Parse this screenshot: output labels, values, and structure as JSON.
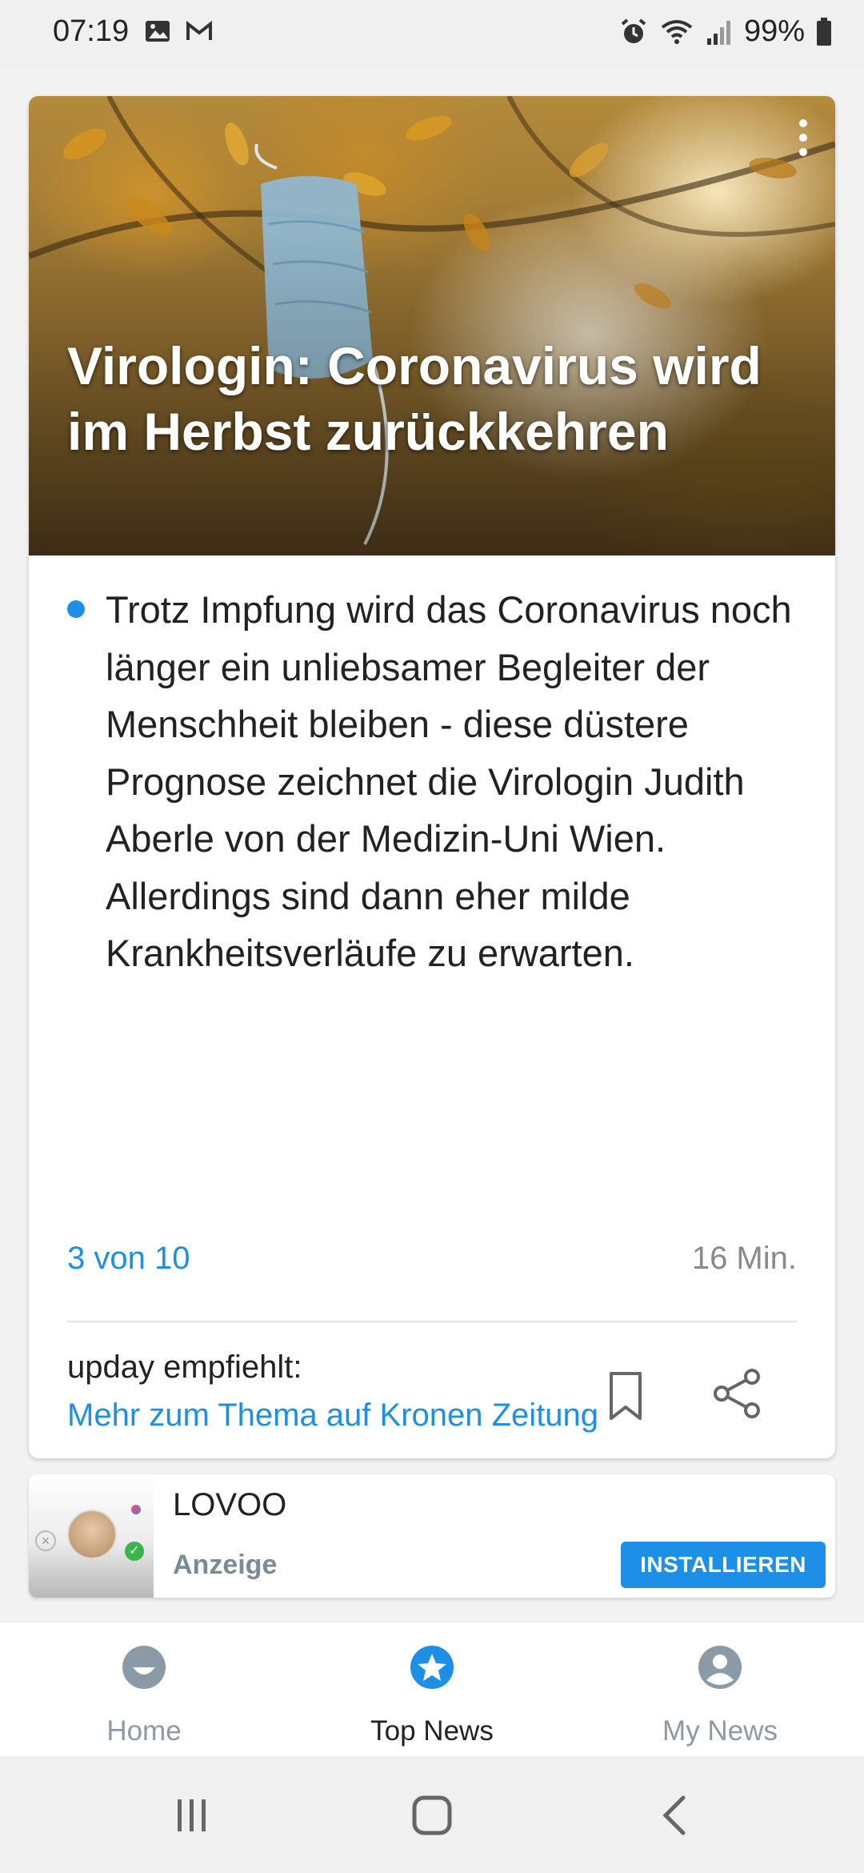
{
  "status_bar": {
    "time": "07:19",
    "battery": "99%",
    "left_icons": [
      "image-icon",
      "gmail-icon"
    ],
    "right_icons": [
      "alarm-icon",
      "wifi-icon",
      "signal-icon",
      "battery-icon"
    ]
  },
  "article": {
    "headline": "Virologin: Coronavirus wird im Herbst zurückkehren",
    "body": "Trotz Impfung wird das Coronavirus noch länger ein unliebsamer Begleiter der Menschheit bleiben - diese düstere Prognose zeichnet die Virologin Judith Aberle von der Medizin-Uni Wien. Allerdings sind dann eher milde Krankheitsverläufe zu erwarten.",
    "counter": "3 von 10",
    "duration": "16 Min.",
    "recommend_label": "upday empfiehlt:",
    "recommend_link": "Mehr zum Thema auf Kronen Zeitung"
  },
  "ad": {
    "title": "LOVOO",
    "label": "Anzeige",
    "button": "INSTALLIEREN"
  },
  "bottom_nav": {
    "items": [
      {
        "label": "Home",
        "icon": "home-face-icon",
        "active": false
      },
      {
        "label": "Top News",
        "icon": "star-icon",
        "active": true
      },
      {
        "label": "My News",
        "icon": "profile-icon",
        "active": false
      }
    ]
  },
  "colors": {
    "accent": "#1e8fe6",
    "nav_inactive": "#8a9aa6",
    "text": "#222222"
  }
}
